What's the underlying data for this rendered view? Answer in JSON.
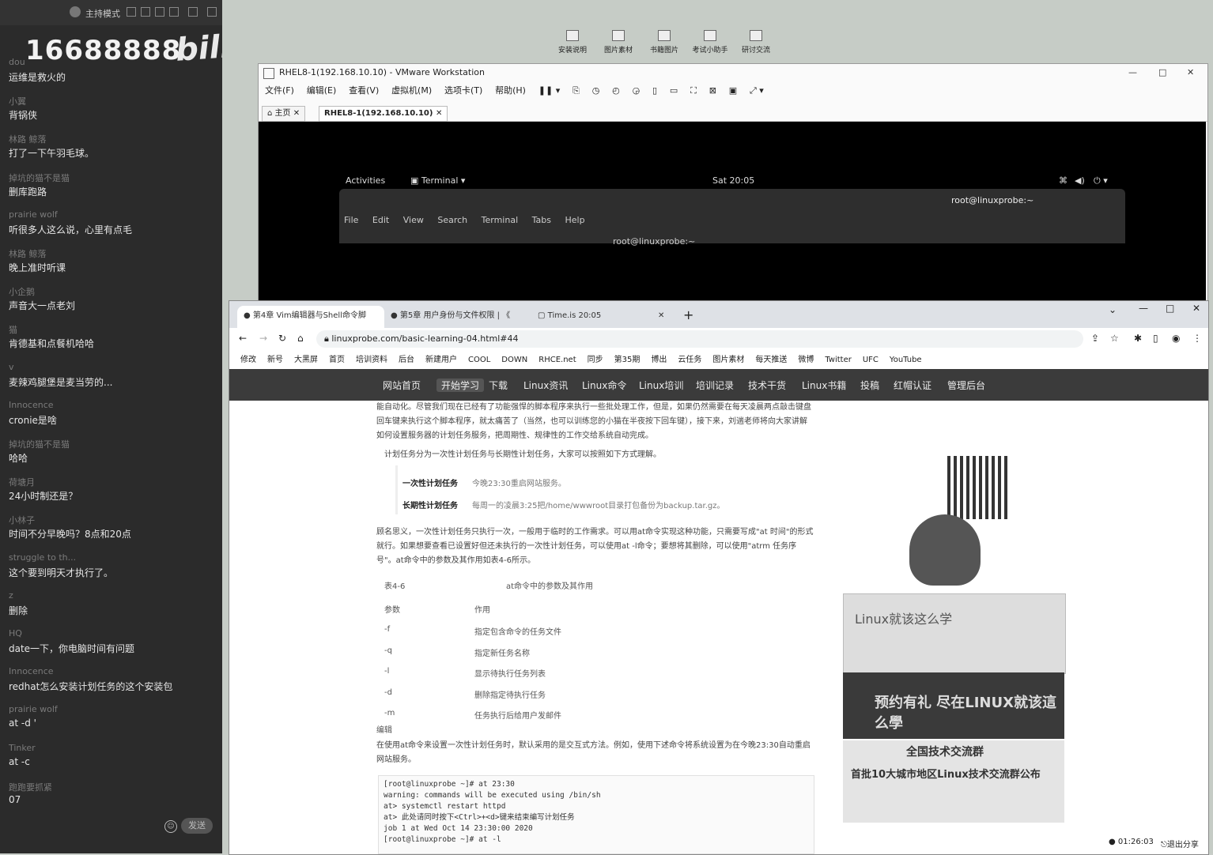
{
  "chat": {
    "mode_label": "主持模式",
    "big_number": "16688888",
    "logo": "bilibili",
    "messages": [
      {
        "user": "dou",
        "text": "运维是救火的"
      },
      {
        "user": "小翼",
        "text": "背锅侠"
      },
      {
        "user": "林路 鲸落",
        "text": "打了一下午羽毛球。"
      },
      {
        "user": "掉坑的猫不是猫",
        "text": "删库跑路"
      },
      {
        "user": "prairie wolf",
        "text": "听很多人这么说，心里有点毛"
      },
      {
        "user": "林路 鲸落",
        "text": "晚上准时听课"
      },
      {
        "user": "小企鹅",
        "text": "声音大一点老刘"
      },
      {
        "user": "猫",
        "text": "肯德基和点餐机哈哈"
      },
      {
        "user": "v",
        "text": "麦辣鸡腿堡是麦当劳的..."
      },
      {
        "user": "Innocence",
        "text": "cronie是啥"
      },
      {
        "user": "掉坑的猫不是猫",
        "text": "哈哈"
      },
      {
        "user": "荷塘月",
        "text": "24小时制还是？"
      },
      {
        "user": "小林子",
        "text": "时间不分早晚吗？8点和20点"
      },
      {
        "user": "struggle to th...",
        "text": "这个要到明天才执行了。"
      },
      {
        "user": "z",
        "text": "删除"
      },
      {
        "user": "HQ",
        "text": "date一下，你电脑时间有问题"
      },
      {
        "user": "Innocence",
        "text": "redhat怎么安装计划任务的这个安装包"
      },
      {
        "user": "prairie wolf",
        "text": "at -d '"
      },
      {
        "user": "Tinker",
        "text": "at -c"
      },
      {
        "user": "跑跑要抓紧",
        "text": "07"
      }
    ],
    "emoji_glyph": "☺",
    "send_label": "发送"
  },
  "desktop": {
    "icons": [
      "安装说明",
      "图片素材",
      "书籍图片",
      "考试小助手",
      "研讨交流"
    ]
  },
  "vmware": {
    "title": "RHEL8-1(192.168.10.10) - VMware Workstation",
    "menu": [
      "文件(F)",
      "编辑(E)",
      "查看(V)",
      "虚拟机(M)",
      "选项卡(T)",
      "帮助(H)"
    ],
    "tabs": [
      "主页",
      "RHEL8-1(192.168.10.10)"
    ],
    "gnome": {
      "activities": "Activities",
      "app": "Terminal ▾",
      "clock": "Sat 20:05"
    },
    "terminal": {
      "title": "root@linuxprobe:~",
      "menu": [
        "File",
        "Edit",
        "View",
        "Search",
        "Terminal",
        "Tabs",
        "Help"
      ],
      "peek": "root@linuxprobe:~"
    }
  },
  "chrome": {
    "tabs": [
      "第4章 Vim编辑器与Shell命令脚",
      "第5章 用户身份与文件权限 | 《",
      "Time.is 20:05"
    ],
    "url": "linuxprobe.com/basic-learning-04.html#44",
    "bookmarks": [
      "修改",
      "新号",
      "大黑屏",
      "首页",
      "培训资料",
      "后台",
      "新建用户",
      "COOL",
      "DOWN",
      "RHCE.net",
      "同步",
      "第35期",
      "博出",
      "云任务",
      "图片素材",
      "每天推送",
      "微博",
      "Twitter",
      "UFC",
      "YouTube"
    ],
    "site_nav": [
      "网站首页",
      "开始学习",
      "下载",
      "Linux资讯",
      "Linux命令",
      "Linux培训",
      "培训记录",
      "技术干货",
      "Linux书籍",
      "投稿",
      "红帽认证",
      "管理后台"
    ],
    "article": {
      "p1": "能自动化。尽管我们现在已经有了功能强悍的脚本程序来执行一些批处理工作，但是，如果仍然需要在每天凌晨两点敲击键盘回车键来执行这个脚本程序，就太痛苦了（当然，也可以训练您的小猫在半夜按下回车键），接下来，刘遄老师将向大家讲解如何设置服务器的计划任务服务，把周期性、规律性的工作交给系统自动完成。",
      "p2": "计划任务分为一次性计划任务与长期性计划任务，大家可以按照如下方式理解。",
      "once_label": "一次性计划任务",
      "once_text": "今晚23:30重启网站服务。",
      "long_label": "长期性计划任务",
      "long_text": "每周一的凌晨3:25把/home/wwwroot目录打包备份为backup.tar.gz。",
      "p3": "顾名思义，一次性计划任务只执行一次，一般用于临时的工作需求。可以用at命令实现这种功能，只需要写成\"at 时间\"的形式就行。如果想要查看已设置好但还未执行的一次性计划任务，可以使用at -l命令；要想将其删除，可以使用\"atrm 任务序号\"。at命令中的参数及其作用如表4-6所示。",
      "table_num": "表4-6",
      "table_caption": "at命令中的参数及其作用",
      "th_param": "参数",
      "th_effect": "作用",
      "rows": [
        {
          "p": "-f",
          "e": "指定包含命令的任务文件"
        },
        {
          "p": "-q",
          "e": "指定新任务名称"
        },
        {
          "p": "-l",
          "e": "显示待执行任务列表"
        },
        {
          "p": "-d",
          "e": "删除指定待执行任务"
        },
        {
          "p": "-m",
          "e": "任务执行后给用户发邮件"
        }
      ],
      "edit": "编辑",
      "p4": "在使用at命令来设置一次性计划任务时，默认采用的是交互式方法。例如，使用下述命令将系统设置为在今晚23:30自动重启网站服务。",
      "code": [
        "[root@linuxprobe ~]# at 23:30",
        "warning: commands will be executed using /bin/sh",
        "at> systemctl restart httpd",
        "at> 此处请同时按下<Ctrl>+<d>键来结束编写计划任务",
        "job 1 at Wed Oct 14 23:30:00 2020",
        "[root@linuxprobe ~]# at -l"
      ]
    },
    "sidebar": {
      "ad1": "Linux就该这么学",
      "ad2": "预约有礼 尽在LINUX就该這么學",
      "ad3_title": "全国技术交流群",
      "ad3_sub": "首批10大城市地区Linux技术交流群公布"
    }
  },
  "taskbar": {
    "time": "01:26:03",
    "exit_share": "退出分享"
  }
}
